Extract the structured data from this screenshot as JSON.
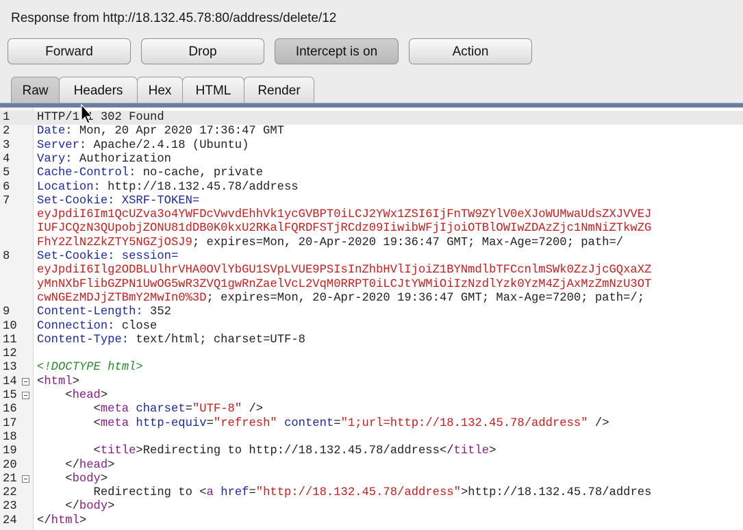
{
  "window": {
    "title": "Response from http://18.132.45.78:80/address/delete/12"
  },
  "toolbar": {
    "forward": "Forward",
    "drop": "Drop",
    "intercept": "Intercept is on",
    "action": "Action"
  },
  "tabs": [
    "Raw",
    "Headers",
    "Hex",
    "HTML",
    "Render"
  ],
  "editor": {
    "lines": [
      {
        "n": "1",
        "parts": [
          {
            "c": "t",
            "s": "HTTP/1.1 302 Found"
          }
        ]
      },
      {
        "n": "2",
        "parts": [
          {
            "c": "h",
            "s": "Date:"
          },
          {
            "c": "t",
            "s": " Mon, 20 Apr 2020 17:36:47 GMT"
          }
        ]
      },
      {
        "n": "3",
        "parts": [
          {
            "c": "h",
            "s": "Server:"
          },
          {
            "c": "t",
            "s": " Apache/2.4.18 (Ubuntu)"
          }
        ]
      },
      {
        "n": "4",
        "parts": [
          {
            "c": "h",
            "s": "Vary:"
          },
          {
            "c": "t",
            "s": " Authorization"
          }
        ]
      },
      {
        "n": "5",
        "parts": [
          {
            "c": "h",
            "s": "Cache-Control:"
          },
          {
            "c": "t",
            "s": " no-cache, private"
          }
        ]
      },
      {
        "n": "6",
        "parts": [
          {
            "c": "h",
            "s": "Location:"
          },
          {
            "c": "t",
            "s": " http://18.132.45.78/address"
          }
        ]
      },
      {
        "n": "7",
        "parts": [
          {
            "c": "h",
            "s": "Set-Cookie: "
          },
          {
            "c": "h",
            "s": "XSRF-TOKEN="
          }
        ]
      },
      {
        "n": "",
        "parts": [
          {
            "c": "r",
            "s": "eyJpdiI6Im1QcUZva3o4YWFDcVwvdEhhVk1ycGVBPT0iLCJ2YWx1ZSI6IjFnTW9ZYlV0eXJoWUMwaUdsZXJVVEJ"
          }
        ]
      },
      {
        "n": "",
        "parts": [
          {
            "c": "r",
            "s": "IUFJCQzN3QUpobjZONU81dDB0K0kxU2RKalFQRDFSTjRCdz09IiwibWFjIjoiOTBlOWIwZDAzZjc1NmNiZTkwZG"
          }
        ]
      },
      {
        "n": "",
        "parts": [
          {
            "c": "r",
            "s": "FhY2ZlN2ZkZTY5NGZjOSJ9"
          },
          {
            "c": "t",
            "s": "; expires=Mon, 20-Apr-2020 19:36:47 GMT; Max-Age=7200; path=/"
          }
        ]
      },
      {
        "n": "8",
        "parts": [
          {
            "c": "h",
            "s": "Set-Cookie: "
          },
          {
            "c": "h",
            "s": "session="
          }
        ]
      },
      {
        "n": "",
        "parts": [
          {
            "c": "r",
            "s": "eyJpdiI6Ilg2ODBLUlhrVHA0OVlYbGU1SVpLVUE9PSIsInZhbHVlIjoiZ1BYNmdlbTFCcnlmSWk0ZzJjcGQxaXZ"
          }
        ]
      },
      {
        "n": "",
        "parts": [
          {
            "c": "r",
            "s": "yMnNXbFlibGZPN1UwOG5wR3ZVQ1gwRnZaelVcL2VqM0RRPT0iLCJtYWMiOiIzNzdlYzk0YzM4ZjAxMzZmNzU3OT"
          }
        ]
      },
      {
        "n": "",
        "parts": [
          {
            "c": "r",
            "s": "cwNGEzMDJjZTBmY2MwIn0%3D"
          },
          {
            "c": "t",
            "s": "; expires=Mon, 20-Apr-2020 19:36:47 GMT; Max-Age=7200; path=/;"
          }
        ]
      },
      {
        "n": "9",
        "parts": [
          {
            "c": "h",
            "s": "Content-Length:"
          },
          {
            "c": "t",
            "s": " 352"
          }
        ]
      },
      {
        "n": "10",
        "parts": [
          {
            "c": "h",
            "s": "Connection:"
          },
          {
            "c": "t",
            "s": " close"
          }
        ]
      },
      {
        "n": "11",
        "parts": [
          {
            "c": "h",
            "s": "Content-Type:"
          },
          {
            "c": "t",
            "s": " text/html; charset=UTF-8"
          }
        ]
      },
      {
        "n": "12",
        "parts": []
      },
      {
        "n": "13",
        "parts": [
          {
            "c": "g",
            "s": "<!DOCTYPE html>"
          }
        ]
      },
      {
        "n": "14",
        "fold": true,
        "parts": [
          {
            "c": "p",
            "s": "<"
          },
          {
            "c": "tg",
            "s": "html"
          },
          {
            "c": "p",
            "s": ">"
          }
        ]
      },
      {
        "n": "15",
        "fold": true,
        "parts": [
          {
            "c": "p",
            "s": "    <"
          },
          {
            "c": "tg",
            "s": "head"
          },
          {
            "c": "p",
            "s": ">"
          }
        ]
      },
      {
        "n": "16",
        "parts": [
          {
            "c": "p",
            "s": "        <"
          },
          {
            "c": "tg",
            "s": "meta"
          },
          {
            "c": "at",
            "s": " charset"
          },
          {
            "c": "p",
            "s": "="
          },
          {
            "c": "av",
            "s": "\"UTF-8\""
          },
          {
            "c": "p",
            "s": " />"
          }
        ]
      },
      {
        "n": "17",
        "parts": [
          {
            "c": "p",
            "s": "        <"
          },
          {
            "c": "tg",
            "s": "meta"
          },
          {
            "c": "at",
            "s": " http-equiv"
          },
          {
            "c": "p",
            "s": "="
          },
          {
            "c": "av",
            "s": "\"refresh\""
          },
          {
            "c": "at",
            "s": " content"
          },
          {
            "c": "p",
            "s": "="
          },
          {
            "c": "av",
            "s": "\"1;url=http://18.132.45.78/address\""
          },
          {
            "c": "p",
            "s": " />"
          }
        ]
      },
      {
        "n": "18",
        "parts": []
      },
      {
        "n": "19",
        "parts": [
          {
            "c": "p",
            "s": "        <"
          },
          {
            "c": "tg",
            "s": "title"
          },
          {
            "c": "p",
            "s": ">Redirecting to http://18.132.45.78/address</"
          },
          {
            "c": "tg",
            "s": "title"
          },
          {
            "c": "p",
            "s": ">"
          }
        ]
      },
      {
        "n": "20",
        "parts": [
          {
            "c": "p",
            "s": "    </"
          },
          {
            "c": "tg",
            "s": "head"
          },
          {
            "c": "p",
            "s": ">"
          }
        ]
      },
      {
        "n": "21",
        "fold": true,
        "parts": [
          {
            "c": "p",
            "s": "    <"
          },
          {
            "c": "tg",
            "s": "body"
          },
          {
            "c": "p",
            "s": ">"
          }
        ]
      },
      {
        "n": "22",
        "parts": [
          {
            "c": "p",
            "s": "        Redirecting to <"
          },
          {
            "c": "tg",
            "s": "a"
          },
          {
            "c": "at",
            "s": " href"
          },
          {
            "c": "p",
            "s": "="
          },
          {
            "c": "av",
            "s": "\"http://18.132.45.78/address\""
          },
          {
            "c": "p",
            "s": ">http://18.132.45.78/addres"
          }
        ]
      },
      {
        "n": "23",
        "parts": [
          {
            "c": "p",
            "s": "    </"
          },
          {
            "c": "tg",
            "s": "body"
          },
          {
            "c": "p",
            "s": ">"
          }
        ]
      },
      {
        "n": "24",
        "parts": [
          {
            "c": "p",
            "s": "</"
          },
          {
            "c": "tg",
            "s": "html"
          },
          {
            "c": "p",
            "s": ">"
          }
        ]
      }
    ]
  }
}
